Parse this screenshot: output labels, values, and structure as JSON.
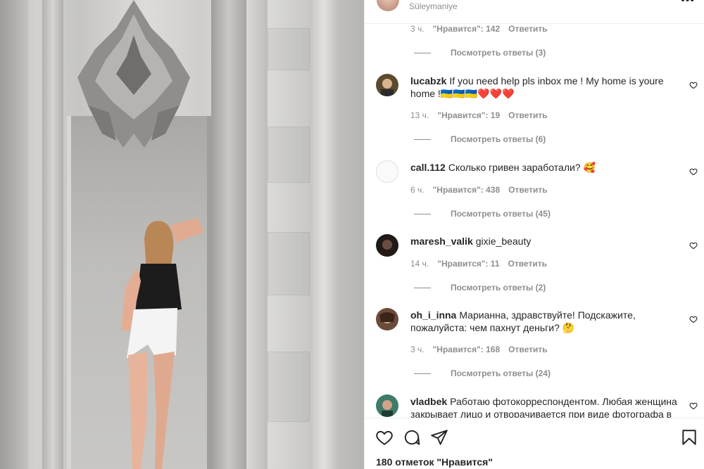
{
  "post": {
    "location": "Süleymaniye",
    "likes_text": "180 отметок \"Нравится\""
  },
  "top_comment_meta": {
    "time": "3 ч.",
    "likes": "\"Нравится\": 142",
    "reply": "Ответить",
    "view_replies": "Посмотреть ответы (3)"
  },
  "comments": [
    {
      "username": "lucabzk",
      "text": "If you need help pls inbox me ! My home is youre home !🇺🇦🇺🇦🇺🇦❤️❤️❤️",
      "time": "13 ч.",
      "likes": "\"Нравится\": 19",
      "reply": "Ответить",
      "view_replies": "Посмотреть ответы (6)"
    },
    {
      "username": "call.112",
      "text": "Сколько гривен заработали? 🥰",
      "time": "6 ч.",
      "likes": "\"Нравится\": 438",
      "reply": "Ответить",
      "view_replies": "Посмотреть ответы (45)"
    },
    {
      "username": "maresh_valik",
      "text": "gixie_beauty",
      "time": "14 ч.",
      "likes": "\"Нравится\": 11",
      "reply": "Ответить",
      "view_replies": "Посмотреть ответы (2)"
    },
    {
      "username": "oh_i_inna",
      "text": "Марианна, здравствуйте! Подскажите, пожалуйста: чем пахнут деньги? 🤔",
      "time": "3 ч.",
      "likes": "\"Нравится\": 168",
      "reply": "Ответить",
      "view_replies": "Посмотреть ответы (24)"
    },
    {
      "username": "vladbek",
      "text": "Работаю фотокорреспондентом. Любая женщина закрывает лицо и отворачивается при виде фотографа в"
    }
  ],
  "icons": {
    "like": "heart-icon",
    "comment": "comment-icon",
    "share": "paper-plane-icon",
    "save": "bookmark-icon",
    "comment_like": "heart-outline-icon",
    "more": "more-horizontal-icon"
  }
}
